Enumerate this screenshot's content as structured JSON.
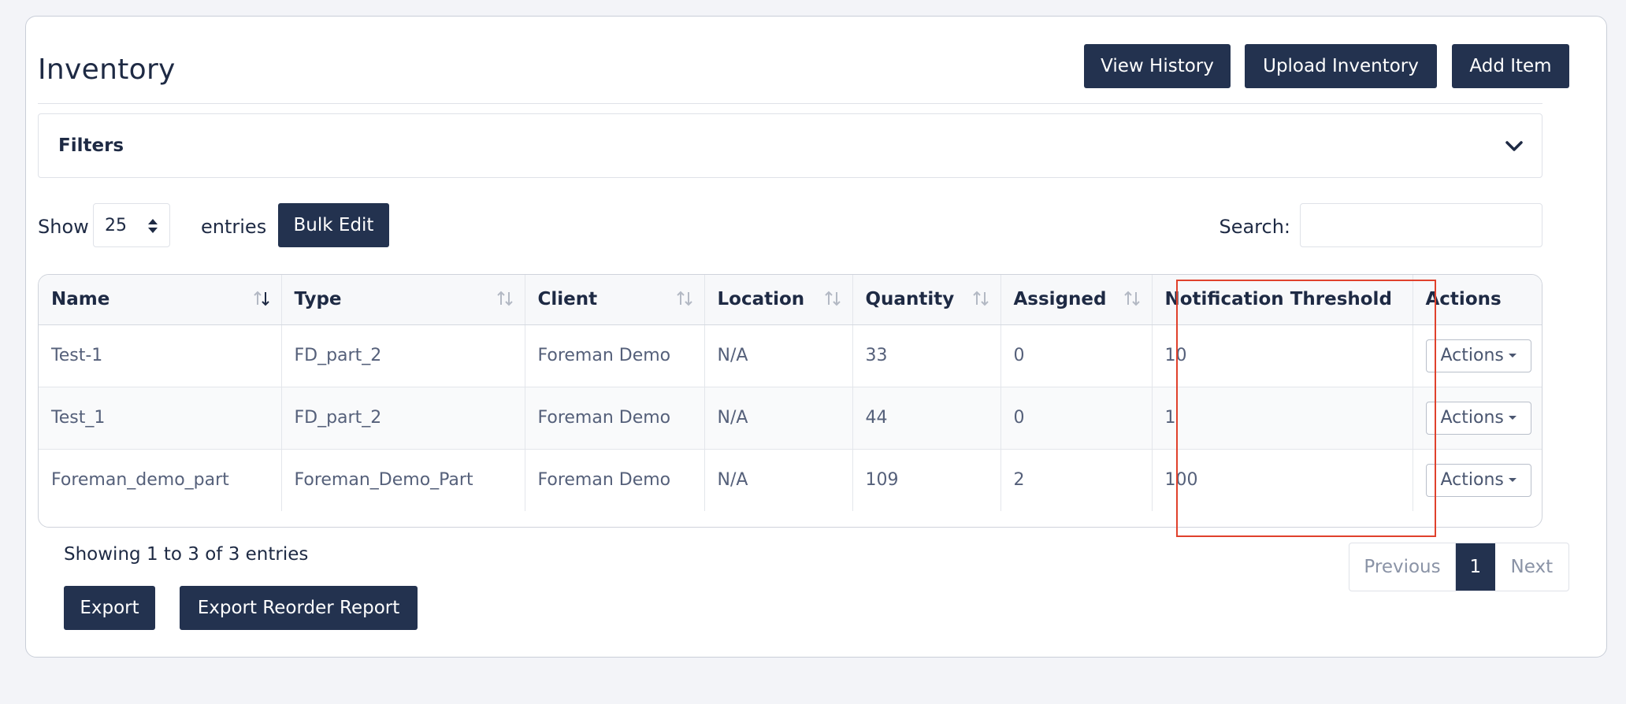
{
  "header": {
    "title": "Inventory",
    "buttons": {
      "view_history": "View History",
      "upload_inventory": "Upload Inventory",
      "add_item": "Add Item"
    }
  },
  "filters": {
    "label": "Filters",
    "toggle_icon": "chevron-down-icon"
  },
  "controls": {
    "show_label": "Show",
    "entries_value": "25",
    "entries_label": "entries",
    "bulk_edit": "Bulk Edit",
    "search_label": "Search:",
    "search_value": ""
  },
  "table": {
    "columns": [
      "Name",
      "Type",
      "Client",
      "Location",
      "Quantity",
      "Assigned",
      "Notification Threshold",
      "Actions"
    ],
    "rows": [
      {
        "name": "Test-1",
        "type": "FD_part_2",
        "client": "Foreman Demo",
        "location": "N/A",
        "quantity": "33",
        "assigned": "0",
        "threshold": "10",
        "action": "Actions"
      },
      {
        "name": "Test_1",
        "type": "FD_part_2",
        "client": "Foreman Demo",
        "location": "N/A",
        "quantity": "44",
        "assigned": "0",
        "threshold": "1",
        "action": "Actions"
      },
      {
        "name": "Foreman_demo_part",
        "type": "Foreman_Demo_Part",
        "client": "Foreman Demo",
        "location": "N/A",
        "quantity": "109",
        "assigned": "2",
        "threshold": "100",
        "action": "Actions"
      }
    ]
  },
  "footer": {
    "info": "Showing 1 to 3 of 3 entries",
    "pagination": {
      "previous": "Previous",
      "current": "1",
      "next": "Next"
    },
    "export": "Export",
    "export_reorder": "Export Reorder Report"
  },
  "colors": {
    "primary": "#23324f",
    "highlight": "#e0412c",
    "background": "#f3f4f8"
  }
}
